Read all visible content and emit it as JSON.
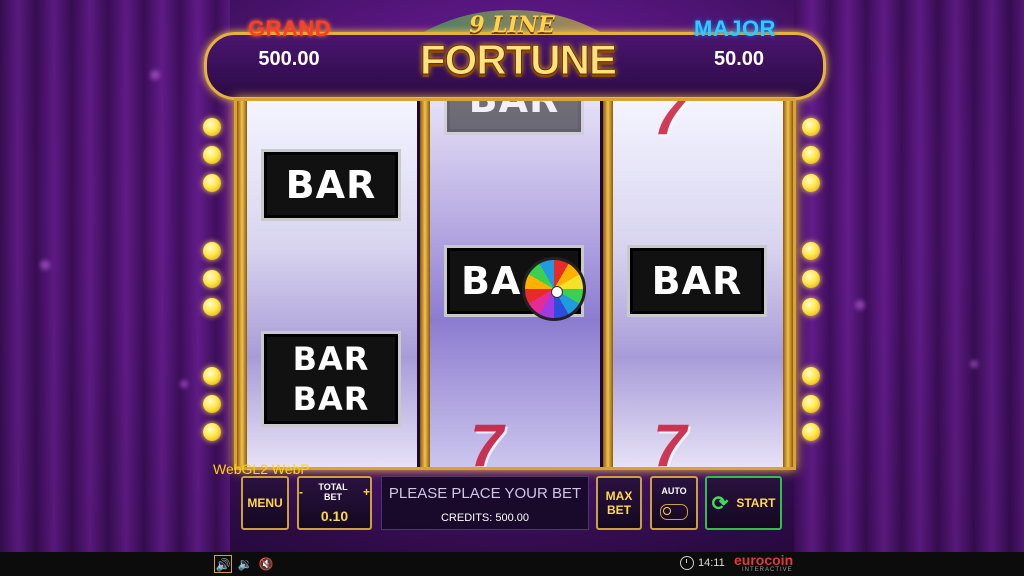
{
  "jackpots": {
    "grand_label": "GRAND",
    "grand_value": "500.00",
    "major_label": "MAJOR",
    "major_value": "50.00"
  },
  "logo": {
    "line1": "9 LINE",
    "line2": "FORTUNE"
  },
  "reels": {
    "reel1": {
      "top": "BAR",
      "double_top": "BAR",
      "double_bottom": "BAR"
    },
    "reel2": {
      "top": "BAR",
      "middle": "BA"
    },
    "reel3": {
      "middle": "BAR"
    }
  },
  "debug_text": "WebGL2  WebP",
  "controls": {
    "menu_label": "MENU",
    "minus": "-",
    "total_bet_label": "TOTAL BET",
    "plus": "+",
    "total_bet_value": "0.10",
    "message": "PLEASE PLACE YOUR BET",
    "credits_text": "CREDITS: 500.00",
    "max_bet_line1": "MAX",
    "max_bet_line2": "BET",
    "auto_label": "AUTO",
    "start_label": "START"
  },
  "footer": {
    "time": "14:11",
    "brand": "eurocoin",
    "brand_sub": "INTERACTIVE"
  },
  "icons": {
    "refresh_icon": "⟳",
    "sound_active_icon": "🔊",
    "sound_icon_2": "🔉",
    "mute_icon": "🔇"
  },
  "colors": {
    "accent_gold": "#d9a32d",
    "grand_red": "#ff3b2f",
    "major_blue": "#34c8ff",
    "start_green": "#2fbf4a"
  }
}
